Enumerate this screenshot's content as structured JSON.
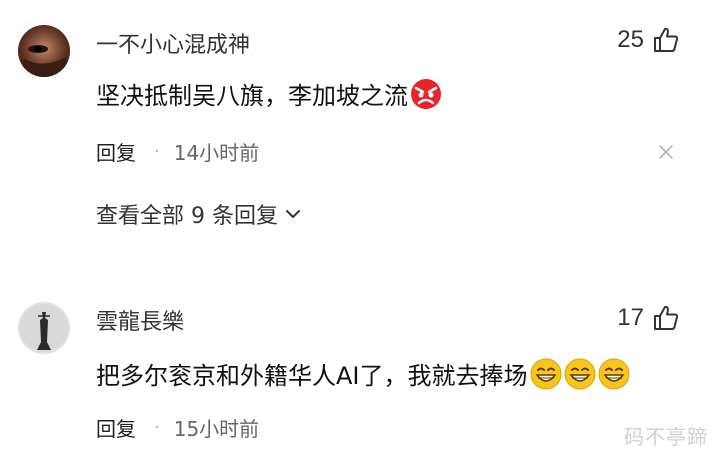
{
  "comments": [
    {
      "username": "一不小心混成神",
      "likes": "25",
      "text": "坚决抵制吴八旗，李加坡之流",
      "emojis": [
        "angry-face-emoji"
      ],
      "reply_label": "回复",
      "separator": "·",
      "time": "14小时前",
      "view_replies": "查看全部 9 条回复"
    },
    {
      "username": "雲龍長樂",
      "likes": "17",
      "text": "把多尔衮京和外籍华人AI了，我就去捧场",
      "emojis": [
        "grinning-face-emoji",
        "grinning-face-emoji",
        "grinning-face-emoji"
      ],
      "reply_label": "回复",
      "separator": "·",
      "time": "15小时前"
    }
  ],
  "watermark": "码不亭蹄",
  "colors": {
    "text_primary": "#111111",
    "text_secondary": "#666666",
    "emoji_red": "#e8232c",
    "emoji_yellow": "#f7c51e"
  }
}
